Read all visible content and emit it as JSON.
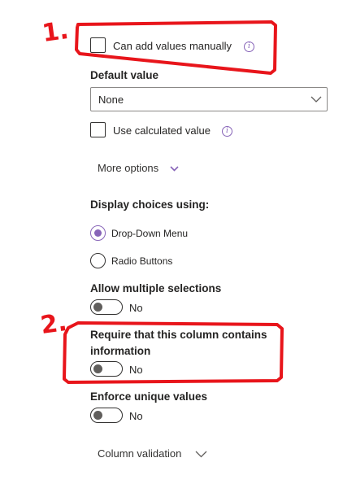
{
  "annotations": {
    "marker_1": "1.",
    "marker_2": "2."
  },
  "manual_values": {
    "label": "Can add values manually",
    "checked": false
  },
  "default_value": {
    "heading": "Default value",
    "selected": "None"
  },
  "calculated": {
    "label": "Use calculated value",
    "checked": false
  },
  "more_options": {
    "label": "More options"
  },
  "display_choices": {
    "heading": "Display choices using:",
    "options": [
      "Drop-Down Menu",
      "Radio Buttons"
    ],
    "selected": "Drop-Down Menu"
  },
  "allow_multiple": {
    "heading": "Allow multiple selections",
    "state": "No"
  },
  "require_info": {
    "heading_line1": "Require that this column contains",
    "heading_line2": "information",
    "state": "No"
  },
  "unique_values": {
    "heading": "Enforce unique values",
    "state": "No"
  },
  "column_validation": {
    "label": "Column validation"
  },
  "colors": {
    "accent": "#8764b8",
    "annotation": "#e8151b",
    "text": "#252423"
  }
}
